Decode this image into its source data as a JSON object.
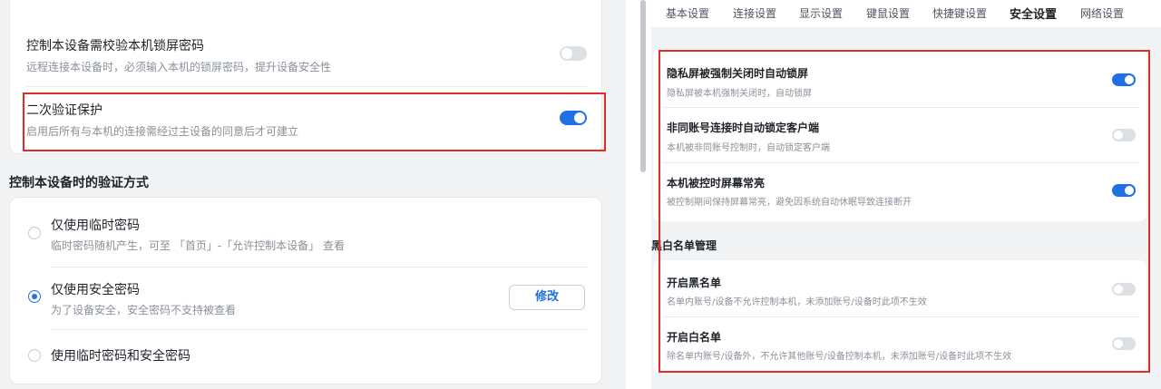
{
  "left": {
    "top_card": {
      "items": [
        {
          "title": "控制本设备需校验本机锁屏密码",
          "desc": "远程连接本设备时，必须输入本机的锁屏密码，提升设备安全性",
          "enabled": false
        },
        {
          "title": "二次验证保护",
          "desc": "启用后所有与本机的连接需经过主设备的同意后才可建立",
          "enabled": true
        }
      ]
    },
    "verify_section": {
      "heading": "控制本设备时的验证方式",
      "options": [
        {
          "title": "仅使用临时密码",
          "desc": "临时密码随机产生，可至 「首页」-「允许控制本设备」 查看",
          "checked": false
        },
        {
          "title": "仅使用安全密码",
          "desc": "为了设备安全，安全密码不支持被查看",
          "checked": true
        },
        {
          "title": "使用临时密码和安全密码",
          "desc": "",
          "checked": false
        }
      ],
      "modify_button": "修改"
    }
  },
  "right": {
    "tabs": [
      {
        "label": "基本设置",
        "active": false
      },
      {
        "label": "连接设置",
        "active": false
      },
      {
        "label": "显示设置",
        "active": false
      },
      {
        "label": "键鼠设置",
        "active": false
      },
      {
        "label": "快捷键设置",
        "active": false
      },
      {
        "label": "安全设置",
        "active": true
      },
      {
        "label": "网络设置",
        "active": false
      }
    ],
    "security_items": [
      {
        "title": "隐私屏被强制关闭时自动锁屏",
        "desc": "隐私屏被本机强制关闭时，自动锁屏",
        "enabled": true
      },
      {
        "title": "非同账号连接时自动锁定客户端",
        "desc": "本机被非同账号控制时，自动锁定客户端",
        "enabled": false
      },
      {
        "title": "本机被控时屏幕常亮",
        "desc": "被控制期间保持屏幕常亮，避免因系统自动休眠导致连接断开",
        "enabled": true
      }
    ],
    "list_section": {
      "heading": "黑白名单管理",
      "items": [
        {
          "title": "开启黑名单",
          "desc": "名单内账号/设备不允许控制本机，未添加账号/设备时此项不生效",
          "enabled": false
        },
        {
          "title": "开启白名单",
          "desc": "除名单内账号/设备外，不允许其他账号/设备控制本机，未添加账号/设备时此项不生效",
          "enabled": false
        }
      ]
    }
  },
  "colors": {
    "accent": "#1f6fe5",
    "highlight_border": "#e02b2b",
    "toggle_off": "#dcdfe3"
  }
}
